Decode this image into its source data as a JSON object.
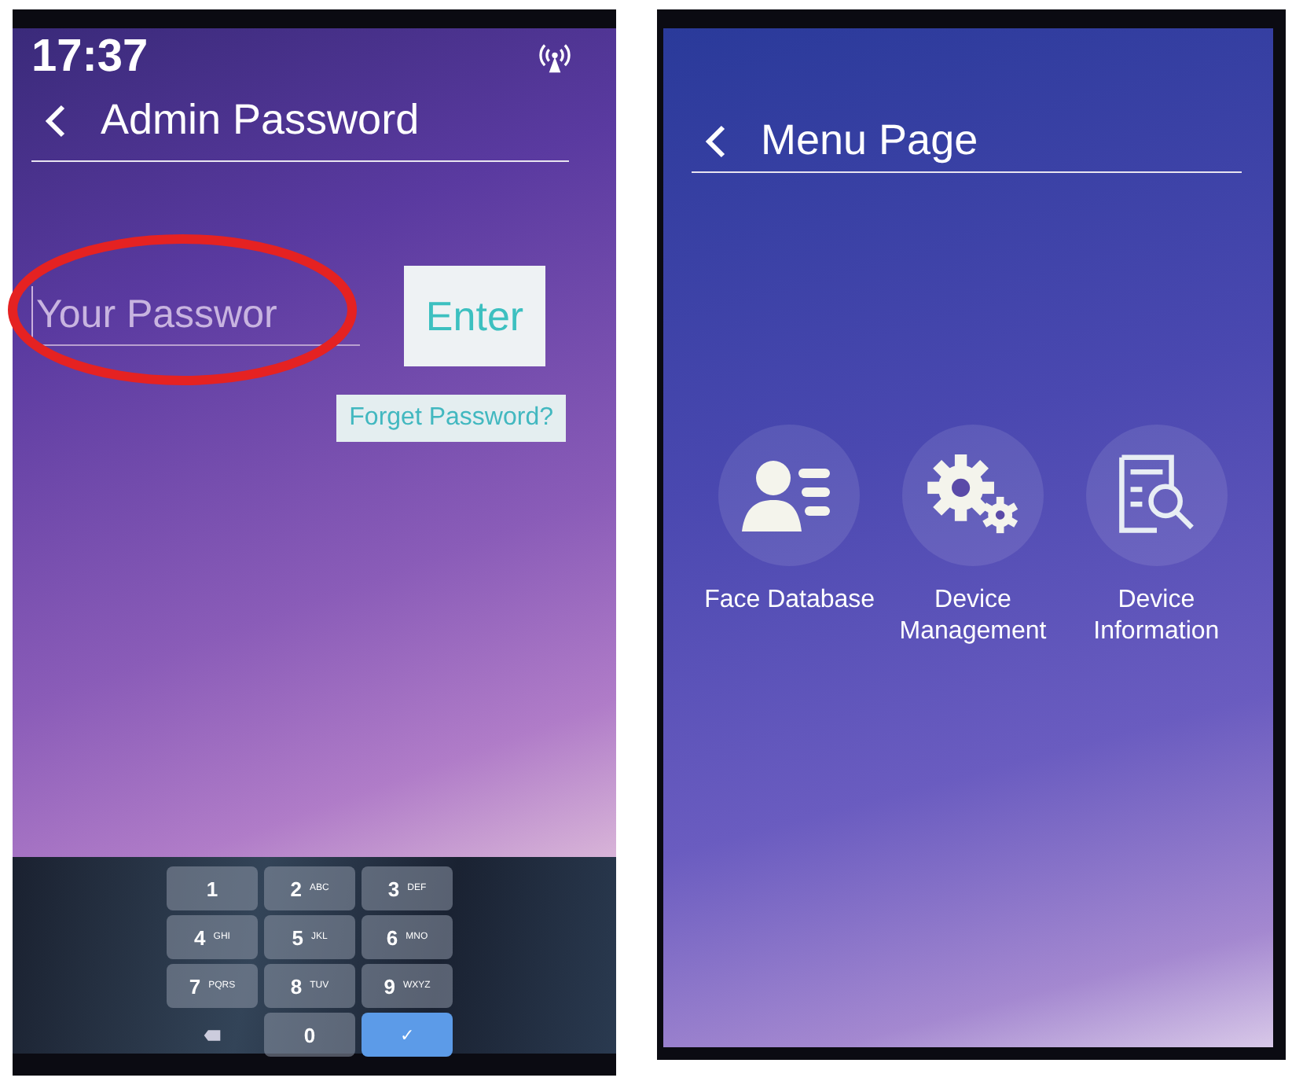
{
  "left_screen": {
    "status_bar": {
      "time": "17:37"
    },
    "title": "Admin Password",
    "password_field": {
      "placeholder": "Your Passwor"
    },
    "enter_button": "Enter",
    "forget_link": "Forget Password?",
    "keypad": [
      {
        "kind": "digit",
        "digit": "1"
      },
      {
        "kind": "digit",
        "digit": "2",
        "letters": "ABC"
      },
      {
        "kind": "digit",
        "digit": "3",
        "letters": "DEF"
      },
      {
        "kind": "digit",
        "digit": "4",
        "letters": "GHI"
      },
      {
        "kind": "digit",
        "digit": "5",
        "letters": "JKL"
      },
      {
        "kind": "digit",
        "digit": "6",
        "letters": "MNO"
      },
      {
        "kind": "digit",
        "digit": "7",
        "letters": "PQRS"
      },
      {
        "kind": "digit",
        "digit": "8",
        "letters": "TUV"
      },
      {
        "kind": "digit",
        "digit": "9",
        "letters": "WXYZ"
      },
      {
        "kind": "backspace"
      },
      {
        "kind": "digit",
        "digit": "0"
      },
      {
        "kind": "confirm",
        "symbol": "✓"
      }
    ]
  },
  "right_screen": {
    "title": "Menu Page",
    "menu_items": [
      {
        "kind": "faces",
        "label": "Face Database"
      },
      {
        "kind": "gears",
        "label": "Device Management"
      },
      {
        "kind": "document-search",
        "label": "Device Information"
      }
    ]
  }
}
